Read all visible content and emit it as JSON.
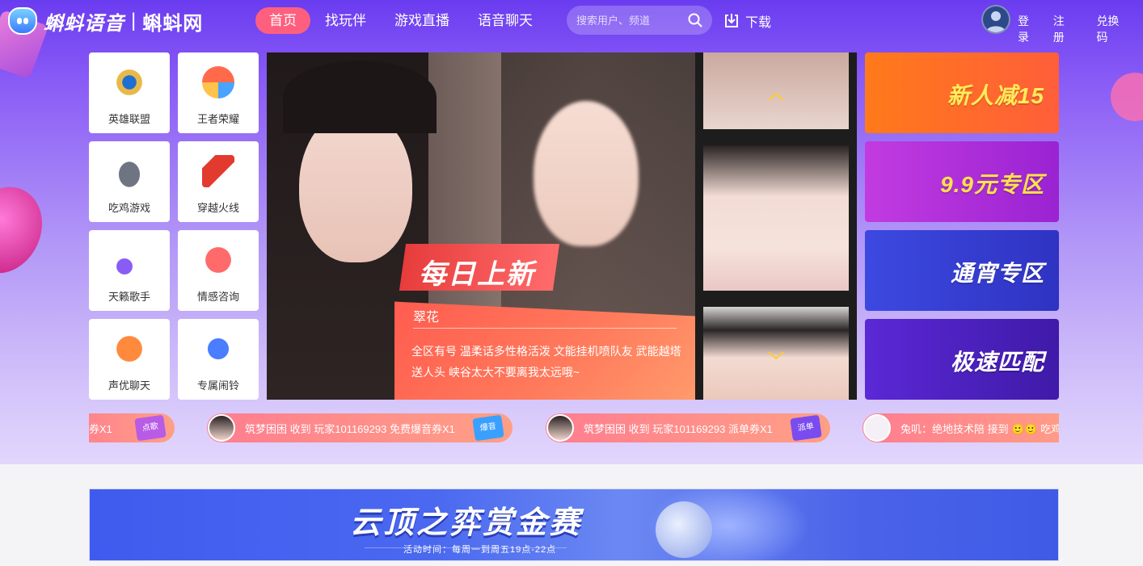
{
  "header": {
    "logo_text": "蝌蚪语音",
    "logo_sep": "|",
    "logo_text2": "蝌蚪网",
    "nav": [
      {
        "label": "首页",
        "active": true
      },
      {
        "label": "找玩伴",
        "active": false
      },
      {
        "label": "游戏直播",
        "active": false
      },
      {
        "label": "语音聊天",
        "active": false
      }
    ],
    "search_placeholder": "搜索用户、频道",
    "download_label": "下载",
    "login_label": "登录",
    "register_label": "注册",
    "redeem_label": "兑换码"
  },
  "games": [
    {
      "label": "英雄联盟",
      "icon": "league-of-legends-icon"
    },
    {
      "label": "王者荣耀",
      "icon": "honor-of-kings-icon"
    },
    {
      "label": "吃鸡游戏",
      "icon": "helmet-icon"
    },
    {
      "label": "穿越火线",
      "icon": "crossfire-icon"
    },
    {
      "label": "天籁歌手",
      "icon": "music-note-icon"
    },
    {
      "label": "情感咨询",
      "icon": "heart-pulse-icon"
    },
    {
      "label": "声优聊天",
      "icon": "voice-bubble-icon"
    },
    {
      "label": "专属闹铃",
      "icon": "alarm-bell-icon"
    }
  ],
  "main_banner": {
    "tag": "每日上新",
    "name": "翠花",
    "description": "全区有号 温柔话多性格活泼 文能挂机喷队友 武能越塔送人头 峡谷太大不要离我太远哦~"
  },
  "promos": [
    {
      "label": "新人减15",
      "color": "#ff6a2c"
    },
    {
      "label": "9.9元专区",
      "color": "#b32ed6"
    },
    {
      "label": "通宵专区",
      "color": "#3a3fd4"
    },
    {
      "label": "极速匹配",
      "color": "#5a1fcf"
    }
  ],
  "ticker": [
    {
      "text": "券X1",
      "badge": "点歌"
    },
    {
      "text": "筑梦困困 收到 玩家101169293 免费爆音券X1",
      "badge": "爆音"
    },
    {
      "text": "筑梦困困 收到 玩家101169293 派单券X1",
      "badge": "派单"
    },
    {
      "text": "兔叽：绝地技术陪 接到 🙂🙂 吃鸡",
      "badge": ""
    }
  ],
  "event_banner": {
    "title": "云顶之弈赏金赛",
    "subtitle": "活动时间：每周一到周五19点-22点"
  }
}
